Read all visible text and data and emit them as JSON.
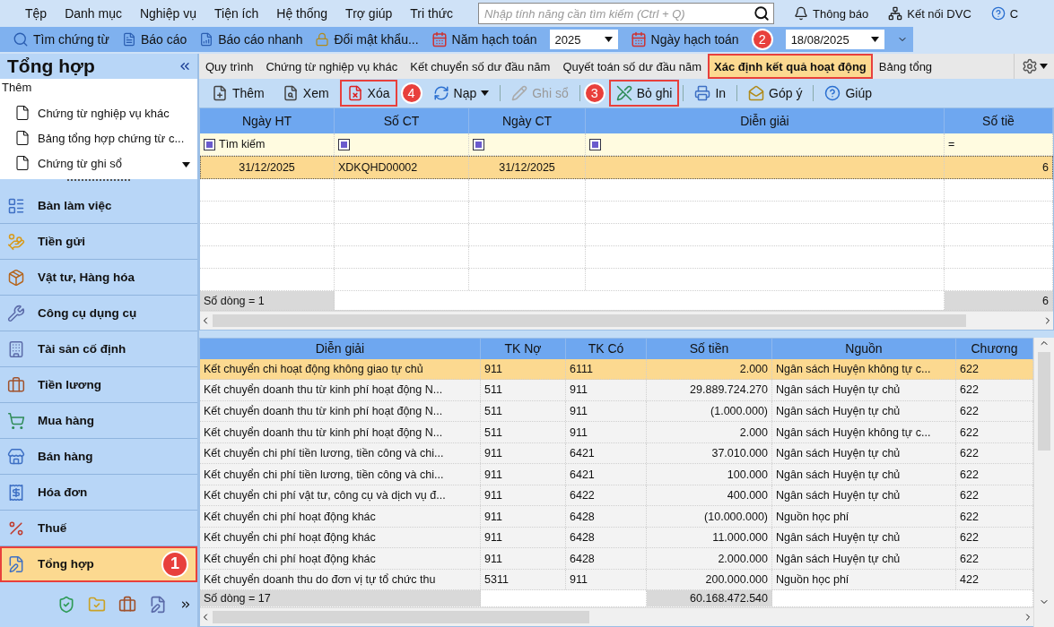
{
  "menu": {
    "items": [
      "Tệp",
      "Danh mục",
      "Nghiệp vụ",
      "Tiện ích",
      "Hệ thống",
      "Trợ giúp",
      "Tri thức"
    ],
    "search": {
      "placeholder": "Nhập tính năng cần tìm kiếm (Ctrl + Q)"
    },
    "right": [
      {
        "label": "Thông báo",
        "kind": "bell"
      },
      {
        "label": "Kết nối DVC",
        "kind": "network"
      },
      {
        "label": "C",
        "kind": "help"
      }
    ]
  },
  "toolbar": {
    "buttons": [
      {
        "label": "Tìm chứng từ",
        "kind": "search"
      },
      {
        "label": "Báo cáo",
        "kind": "report"
      },
      {
        "label": "Báo cáo nhanh",
        "kind": "quick"
      },
      {
        "label": "Đổi mật khẩu...",
        "kind": "lock"
      }
    ],
    "year": {
      "label": "Năm hạch toán",
      "value": "2025"
    },
    "date": {
      "label": "Ngày hạch toán",
      "value": "18/08/2025",
      "callout": "2"
    }
  },
  "sidebar": {
    "title": "Tổng hợp",
    "add_label": "Thêm",
    "quick": [
      "Chứng từ nghiệp vụ khác",
      "Bảng tổng hợp chứng từ c...",
      "Chứng từ ghi sổ"
    ],
    "nav": [
      {
        "label": "Bàn làm việc",
        "kind": "desk",
        "selected": false
      },
      {
        "label": "Tiền gửi",
        "kind": "deposit",
        "selected": false
      },
      {
        "label": "Vật tư, Hàng hóa",
        "kind": "goods",
        "selected": false
      },
      {
        "label": "Công cụ dụng cụ",
        "kind": "tools",
        "selected": false
      },
      {
        "label": "Tài sản cố định",
        "kind": "asset",
        "selected": false
      },
      {
        "label": "Tiền lương",
        "kind": "salary",
        "selected": false
      },
      {
        "label": "Mua hàng",
        "kind": "buy",
        "selected": false
      },
      {
        "label": "Bán hàng",
        "kind": "sell",
        "selected": false
      },
      {
        "label": "Hóa đơn",
        "kind": "invoice",
        "selected": false
      },
      {
        "label": "Thuế",
        "kind": "tax",
        "selected": false
      },
      {
        "label": "Tổng hợp",
        "kind": "summary",
        "selected": true,
        "highlighted": true,
        "callout": "1"
      }
    ]
  },
  "tabs": [
    {
      "label": "Quy trình",
      "selected": false
    },
    {
      "label": "Chứng từ nghiệp vụ khác",
      "selected": false
    },
    {
      "label": "Kết chuyển số dư đầu năm",
      "selected": false
    },
    {
      "label": "Quyết toán số dư đầu năm",
      "selected": false
    },
    {
      "label": "Xác định kết quả hoạt động",
      "selected": true,
      "highlighted": true
    },
    {
      "label": "Bảng tổng",
      "selected": false
    }
  ],
  "actions": [
    {
      "label": "Thêm",
      "kind": "add",
      "disabled": false
    },
    {
      "label": "Xem",
      "kind": "view",
      "disabled": false
    },
    {
      "label": "Xóa",
      "kind": "delete",
      "disabled": false,
      "highlighted": true,
      "callout": "4"
    },
    {
      "label": "Nạp",
      "kind": "reload",
      "disabled": false,
      "dropdown": true
    },
    {
      "label": "Ghi sổ",
      "kind": "post",
      "disabled": true
    },
    {
      "label": "Bỏ ghi",
      "kind": "unpost",
      "disabled": false,
      "highlighted": true,
      "callout": "3"
    },
    {
      "label": "In",
      "kind": "print",
      "disabled": false
    },
    {
      "label": "Góp ý",
      "kind": "feedback",
      "disabled": false
    },
    {
      "label": "Giúp",
      "kind": "help",
      "disabled": false
    }
  ],
  "master": {
    "columns": [
      "Ngày HT",
      "Số CT",
      "Ngày CT",
      "Diễn giải",
      "Số tiề"
    ],
    "filter": [
      {
        "kind": "box",
        "text": "Tìm kiếm"
      },
      {
        "kind": "box"
      },
      {
        "kind": "box"
      },
      {
        "kind": "box"
      },
      {
        "kind": "operator",
        "text": "="
      }
    ],
    "rows": [
      {
        "cells": [
          "31/12/2025",
          "XDKQHD00002",
          "31/12/2025",
          "",
          "6"
        ],
        "selected": true
      }
    ],
    "footer": "Số dòng = 1",
    "total": "6"
  },
  "detail": {
    "columns": [
      "Diễn giải",
      "TK Nợ",
      "TK Có",
      "Số tiền",
      "Nguồn",
      "Chương"
    ],
    "rows": [
      {
        "cells": [
          "Kết chuyển chi hoạt động không giao tự chủ",
          "911",
          "6111",
          "2.000",
          "Ngân sách Huyện không tự c...",
          "622"
        ],
        "selected": true
      },
      {
        "cells": [
          "Kết chuyển doanh thu từ kinh phí hoạt động N...",
          "511",
          "911",
          "29.889.724.270",
          "Ngân sách Huyện tự chủ",
          "622"
        ],
        "selected": false
      },
      {
        "cells": [
          "Kết chuyển doanh thu từ kinh phí hoạt động N...",
          "511",
          "911",
          "(1.000.000)",
          "Ngân sách Huyện tự chủ",
          "622"
        ],
        "selected": false
      },
      {
        "cells": [
          "Kết chuyển doanh thu từ kinh phí hoạt động N...",
          "511",
          "911",
          "2.000",
          "Ngân sách Huyện không tự c...",
          "622"
        ],
        "selected": false
      },
      {
        "cells": [
          "Kết chuyển chi phí tiền lương, tiền công và chi...",
          "911",
          "6421",
          "37.010.000",
          "Ngân sách Huyện tự chủ",
          "622"
        ],
        "selected": false
      },
      {
        "cells": [
          "Kết chuyển chi phí tiền lương, tiền công và chi...",
          "911",
          "6421",
          "100.000",
          "Ngân sách Huyện tự chủ",
          "622"
        ],
        "selected": false
      },
      {
        "cells": [
          "Kết chuyển chi phí vật tư, công cụ và dịch vụ đ...",
          "911",
          "6422",
          "400.000",
          "Ngân sách Huyện tự chủ",
          "622"
        ],
        "selected": false
      },
      {
        "cells": [
          "Kết chuyển chi phí hoạt động khác",
          "911",
          "6428",
          "(10.000.000)",
          "Nguồn học phí",
          "622"
        ],
        "selected": false
      },
      {
        "cells": [
          "Kết chuyển chi phí hoạt động khác",
          "911",
          "6428",
          "11.000.000",
          "Ngân sách Huyện tự chủ",
          "622"
        ],
        "selected": false
      },
      {
        "cells": [
          "Kết chuyển chi phí hoạt động khác",
          "911",
          "6428",
          "2.000.000",
          "Ngân sách Huyện tự chủ",
          "622"
        ],
        "selected": false
      },
      {
        "cells": [
          "Kết chuyển doanh thu do đơn vị tự tổ chức thu",
          "5311",
          "911",
          "200.000.000",
          "Nguồn học phí",
          "422"
        ],
        "selected": false
      }
    ],
    "footer": "Số dòng = 17",
    "total": "60.168.472.540"
  }
}
